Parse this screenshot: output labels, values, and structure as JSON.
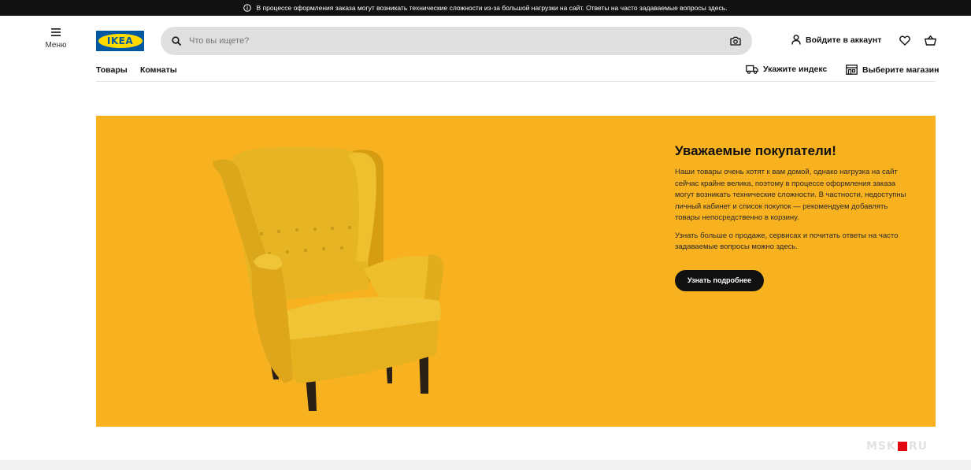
{
  "notice": {
    "text": "В процессе оформления заказа могут возникать технические сложности из-за большой нагрузки на сайт. Ответы на часто задаваемые вопросы здесь."
  },
  "header": {
    "menu_label": "Меню",
    "logo_text": "IKEA",
    "search_placeholder": "Что вы ищете?",
    "account_label": "Войдите в аккаунт"
  },
  "nav": {
    "items": [
      {
        "label": "Товары"
      },
      {
        "label": "Комнаты"
      }
    ],
    "postcode_label": "Укажите индекс",
    "store_label": "Выберите магазин"
  },
  "hero": {
    "title": "Уважаемые покупатели!",
    "paragraph1": "Наши товары очень хотят к вам домой, однако нагрузка на сайт сейчас крайне велика, поэтому в процессе оформления заказа могут возникать технические сложности. В частности, недоступны личный кабинет и список покупок — рекомендуем добавлять товары непосредственно в корзину.",
    "paragraph2": "Узнать больше о продаже, сервисах и почитать ответы на часто задаваемые вопросы можно здесь.",
    "button_label": "Узнать подробнее"
  },
  "watermark": {
    "left": "MSK",
    "right": "RU"
  },
  "colors": {
    "hero_bg": "#f8b11f",
    "brand_blue": "#0058a3",
    "brand_yellow": "#ffdb00",
    "notice_bg": "#111111"
  },
  "icons": [
    "info-icon",
    "hamburger-icon",
    "search-icon",
    "camera-icon",
    "user-icon",
    "heart-icon",
    "basket-icon",
    "truck-icon",
    "store-icon"
  ]
}
